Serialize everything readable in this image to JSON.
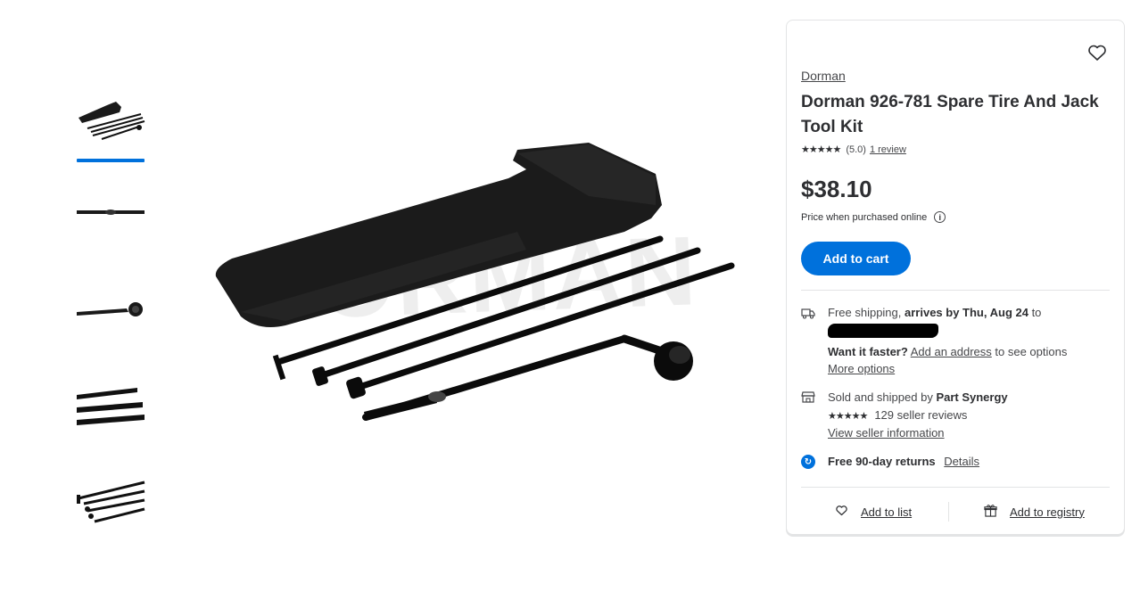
{
  "thumbnails": [
    {
      "name": "kit-overview",
      "active": true
    },
    {
      "name": "single-rod"
    },
    {
      "name": "lug-wrench"
    },
    {
      "name": "rod-ends"
    },
    {
      "name": "rods-fanned"
    }
  ],
  "main_image": {
    "watermark": "DORMAN"
  },
  "product": {
    "brand": "Dorman",
    "title": "Dorman 926-781 Spare Tire And Jack Tool Kit",
    "stars": "★★★★★",
    "rating": "(5.0)",
    "review_count": "1 review",
    "price": "$38.10",
    "price_note": "Price when purchased online",
    "info_icon": "i",
    "add_to_cart": "Add to cart"
  },
  "shipping": {
    "icon": "truck-icon",
    "prefix": "Free shipping, ",
    "arrival": "arrives by Thu, Aug 24",
    "suffix": " to",
    "faster_label": "Want it faster?",
    "add_address": "Add an address",
    "faster_suffix": " to see options",
    "more_options": "More options"
  },
  "seller": {
    "icon": "store-icon",
    "prefix": "Sold and shipped by ",
    "name": "Part Synergy",
    "stars": "★★★★★",
    "reviews": "129 seller reviews",
    "view_info": "View seller information"
  },
  "returns": {
    "icon": "returns-icon",
    "icon_glyph": "↻",
    "label": "Free 90-day returns",
    "details": "Details"
  },
  "footer": {
    "add_to_list": "Add to list",
    "add_to_registry": "Add to registry"
  },
  "colors": {
    "accent": "#0071dc",
    "text": "#2e2f32",
    "muted": "#46474a",
    "border": "#e3e4e5"
  }
}
